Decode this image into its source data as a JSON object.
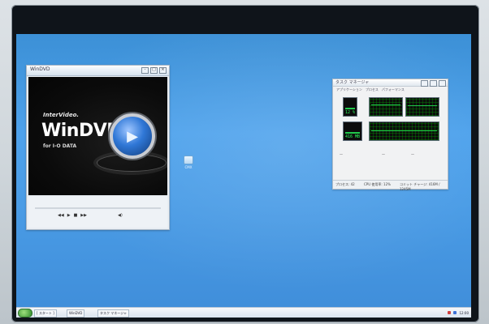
{
  "windvd_window": {
    "title": "WinDVD",
    "brand_top": "InterVideo.",
    "brand_name": "WinDVD",
    "brand_sub": "for I-O DATA",
    "titlebar_buttons": [
      "-",
      "□",
      "×"
    ],
    "controls": {
      "play_label": "▶",
      "prev_label": "◀◀",
      "next_label": "▶▶",
      "stop_label": "■",
      "volume_label": "◀)"
    }
  },
  "performance_window": {
    "title": "タスク マネージャ",
    "tabs": [
      "アプリケーション",
      "プロセス",
      "パフォーマンス"
    ],
    "cpu_value": "12 %",
    "mem_value": "416 MB",
    "footer": {
      "processes": "プロセス: 42",
      "cpu": "CPU 使用率: 12%",
      "commit": "コミット チャージ: 416M / 1245M"
    }
  },
  "desktop_icon": {
    "label": "CMX"
  },
  "taskbar": {
    "items": [
      "[ スタート ]",
      "WinDVD",
      "タスク マネージャ"
    ],
    "clock": "12:00"
  },
  "colors": {
    "desktop_blue": "#4ea2ec",
    "window_bg": "#e9eef3",
    "graph_green": "#2bff5b"
  }
}
